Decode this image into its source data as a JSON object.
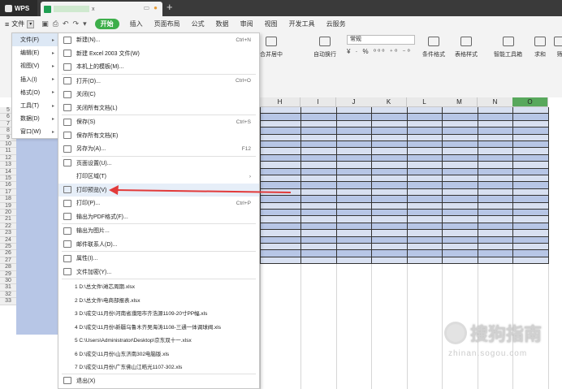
{
  "titlebar": {
    "app": "WPS",
    "doc_ext": "x",
    "add_tab": "+"
  },
  "menubar": {
    "file_label": "文件",
    "start_label": "开始",
    "tabs": [
      "插入",
      "页面布局",
      "公式",
      "数据",
      "审阅",
      "视图",
      "开发工具",
      "云服务"
    ]
  },
  "toolbar": {
    "merge": "合并居中",
    "wrap": "自动换行",
    "format_value": "常规",
    "numfmt": "¥ · % ⁰⁰⁰ ⁺⁰ ⁻⁰",
    "cond_format": "条件格式",
    "table_style": "表格样式",
    "smart_toolbox": "智能工具箱",
    "sum": "求和",
    "filter": "筛"
  },
  "menu_left": [
    {
      "label": "文件(F)",
      "active": true
    },
    {
      "label": "编辑(E)"
    },
    {
      "label": "视图(V)"
    },
    {
      "label": "插入(I)"
    },
    {
      "label": "格式(O)"
    },
    {
      "label": "工具(T)"
    },
    {
      "label": "数据(D)"
    },
    {
      "label": "窗口(W)"
    }
  ],
  "menu_right": {
    "items": [
      {
        "label": "新建(N)...",
        "shortcut": "Ctrl+N"
      },
      {
        "label": "新建 Excel 2003 文件(W)",
        "shortcut": ""
      },
      {
        "label": "本机上的模板(M)...",
        "shortcut": ""
      },
      {
        "label": "打开(O)...",
        "shortcut": "Ctrl+O"
      },
      {
        "label": "关闭(C)",
        "shortcut": ""
      },
      {
        "label": "关闭所有文档(L)",
        "shortcut": ""
      },
      {
        "label": "保存(S)",
        "shortcut": "Ctrl+S"
      },
      {
        "label": "保存所有文档(E)",
        "shortcut": ""
      },
      {
        "label": "另存为(A)...",
        "shortcut": "F12"
      },
      {
        "label": "页面设置(U)...",
        "shortcut": ""
      },
      {
        "label": "打印区域(T)",
        "shortcut": "›"
      },
      {
        "label": "打印预览(V)",
        "shortcut": ""
      },
      {
        "label": "打印(P)...",
        "shortcut": "Ctrl+P"
      },
      {
        "label": "输出为PDF格式(F)...",
        "shortcut": ""
      },
      {
        "label": "输出为图片...",
        "shortcut": ""
      },
      {
        "label": "邮件联系人(D)...",
        "shortcut": ""
      },
      {
        "label": "属性(I)...",
        "shortcut": ""
      },
      {
        "label": "文件加密(Y)...",
        "shortcut": ""
      }
    ],
    "recent": [
      "1 D:\\总文件\\滩芯周期.xlsx",
      "2 D:\\总文件\\电商部报表.xlsx",
      "3 D:\\成交\\11月份\\河南省濮阳市齐浩源1109-20寸PP幅.xls",
      "4 D:\\成交\\11月份\\新疆乌鲁木齐吴海涛1108-三通一体调球阀.xls",
      "5 C:\\Users\\Administrator\\Desktop\\京东双十一.xlsx",
      "6 D:\\成交\\11月份\\山东济南302电脑版.xls",
      "7 D:\\成交\\11月份\\广东佛山江皓光1107-302.xls"
    ],
    "exit": "退出(X)"
  },
  "columns": [
    "H",
    "I",
    "J",
    "K",
    "L",
    "M",
    "N",
    "O"
  ],
  "rows": [
    "5",
    "6",
    "7",
    "8",
    "9",
    "10",
    "11",
    "12",
    "13",
    "14",
    "15",
    "16",
    "17",
    "18",
    "19",
    "20",
    "21",
    "22",
    "23",
    "24",
    "25",
    "26",
    "27",
    "28",
    "29",
    "30",
    "31",
    "32",
    "33"
  ],
  "watermark": {
    "text": "搜狗指南",
    "url": "zhinan.sogou.com"
  }
}
